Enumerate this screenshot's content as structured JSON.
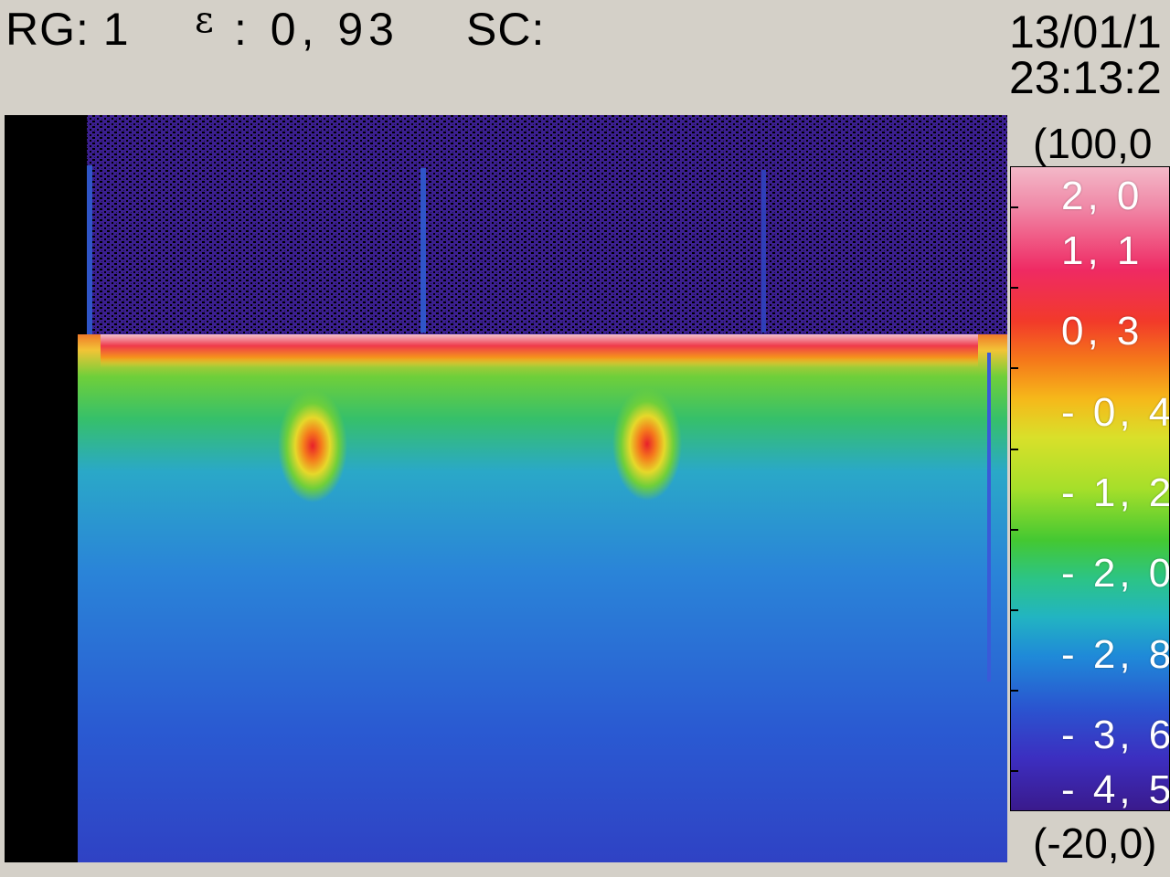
{
  "header": {
    "rg": "RG: 1",
    "epsilon_symbol": "ε",
    "epsilon": ": 0, 93",
    "sc": "SC:",
    "date": "13/01/1",
    "time": "23:13:2"
  },
  "scale": {
    "max": "(100,0",
    "min": "(-20,0)",
    "labels": [
      "2, 0",
      "1, 1",
      "0, 3",
      "- 0, 4",
      "- 1, 2",
      "- 2, 0",
      "- 2, 8",
      "- 3, 6",
      "- 4, 5"
    ]
  },
  "image": {
    "description_colors": {
      "cold": "#2f3fc8",
      "cool": "#2a7fd6",
      "warm": "#3fc23c",
      "hot": "#f05a1e",
      "hottest": "#f5b8c4",
      "background": "#35208a"
    }
  }
}
